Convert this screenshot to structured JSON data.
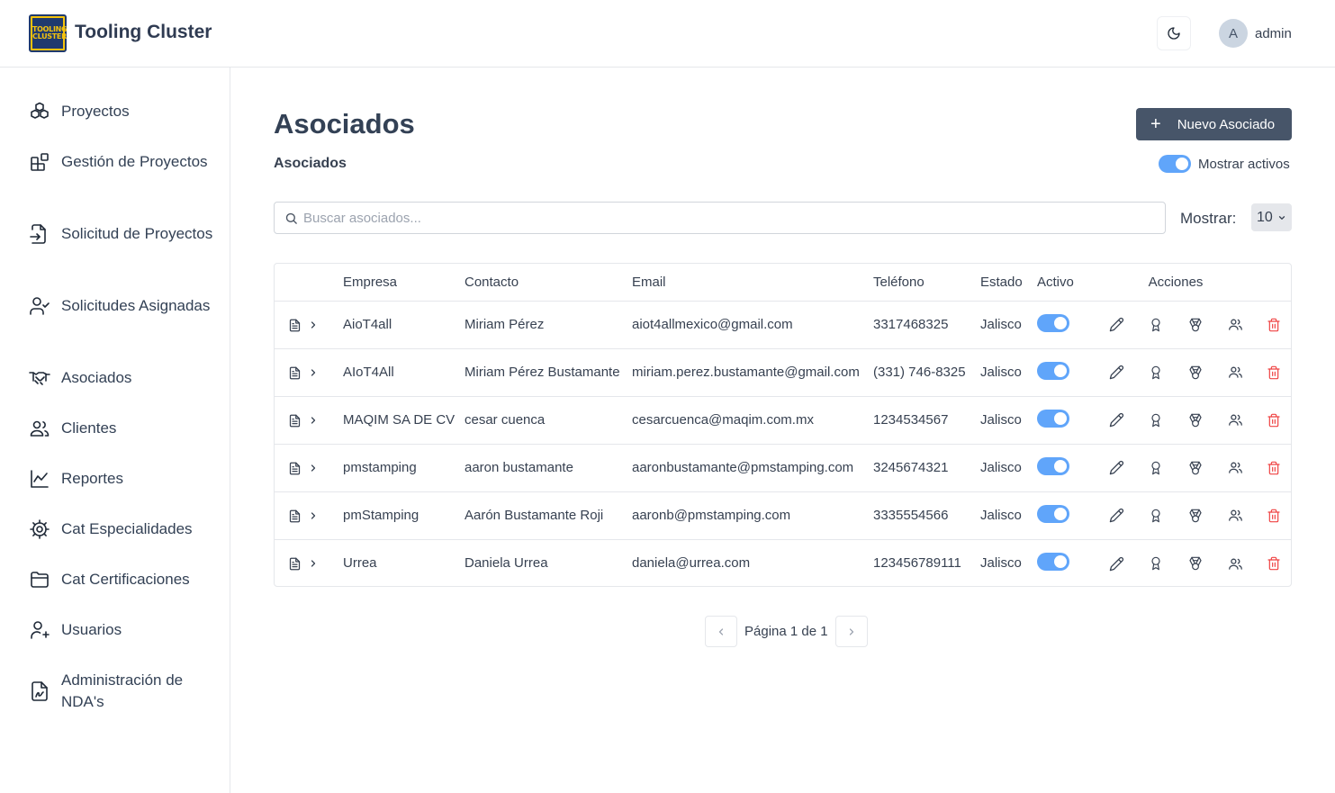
{
  "header": {
    "logo_text": "TOOLING CLUSTER",
    "app_title": "Tooling Cluster",
    "user_initial": "A",
    "user_name": "admin"
  },
  "sidebar": {
    "items": [
      {
        "label": "Proyectos",
        "icon": "boxes-icon"
      },
      {
        "label": "Gestión de Proyectos",
        "icon": "blocks-icon"
      },
      {
        "label": "Solicitud de Proyectos",
        "icon": "file-input-icon"
      },
      {
        "label": "Solicitudes Asignadas",
        "icon": "user-check-icon"
      },
      {
        "label": "Asociados",
        "icon": "handshake-icon"
      },
      {
        "label": "Clientes",
        "icon": "users-icon"
      },
      {
        "label": "Reportes",
        "icon": "line-chart-icon"
      },
      {
        "label": "Cat Especialidades",
        "icon": "cog-icon"
      },
      {
        "label": "Cat Certificaciones",
        "icon": "folder-icon"
      },
      {
        "label": "Usuarios",
        "icon": "user-plus-icon"
      },
      {
        "label": "Administración de NDA's",
        "icon": "file-signature-icon"
      }
    ]
  },
  "main": {
    "title": "Asociados",
    "new_button": "Nuevo Asociado",
    "subtitle": "Asociados",
    "show_active_label": "Mostrar activos",
    "show_active": true,
    "search_placeholder": "Buscar asociados...",
    "show_label": "Mostrar:",
    "page_size": "10"
  },
  "table": {
    "headers": [
      "Empresa",
      "Contacto",
      "Email",
      "Teléfono",
      "Estado",
      "Activo",
      "Acciones"
    ],
    "rows": [
      {
        "empresa": "AioT4all",
        "contacto": "Miriam Pérez",
        "email": "aiot4allmexico@gmail.com",
        "telefono": "3317468325",
        "estado": "Jalisco",
        "activo": true
      },
      {
        "empresa": "AIoT4All",
        "contacto": "Miriam Pérez Bustamante",
        "email": "miriam.perez.bustamante@gmail.com",
        "telefono": "(331) 746-8325",
        "estado": "Jalisco",
        "activo": true
      },
      {
        "empresa": "MAQIM SA DE CV",
        "contacto": "cesar cuenca",
        "email": "cesarcuenca@maqim.com.mx",
        "telefono": "1234534567",
        "estado": "Jalisco",
        "activo": true
      },
      {
        "empresa": "pmstamping",
        "contacto": "aaron bustamante",
        "email": "aaronbustamante@pmstamping.com",
        "telefono": "3245674321",
        "estado": "Jalisco",
        "activo": true
      },
      {
        "empresa": "pmStamping",
        "contacto": "Aarón Bustamante Roji",
        "email": "aaronb@pmstamping.com",
        "telefono": "3335554566",
        "estado": "Jalisco",
        "activo": true
      },
      {
        "empresa": "Urrea",
        "contacto": "Daniela Urrea",
        "email": "daniela@urrea.com",
        "telefono": "123456789111",
        "estado": "Jalisco",
        "activo": true
      }
    ]
  },
  "pagination": {
    "text": "Página 1 de 1"
  },
  "colors": {
    "primary_button": "#475569",
    "toggle_on": "#60a5fa",
    "delete": "#ef4444"
  }
}
